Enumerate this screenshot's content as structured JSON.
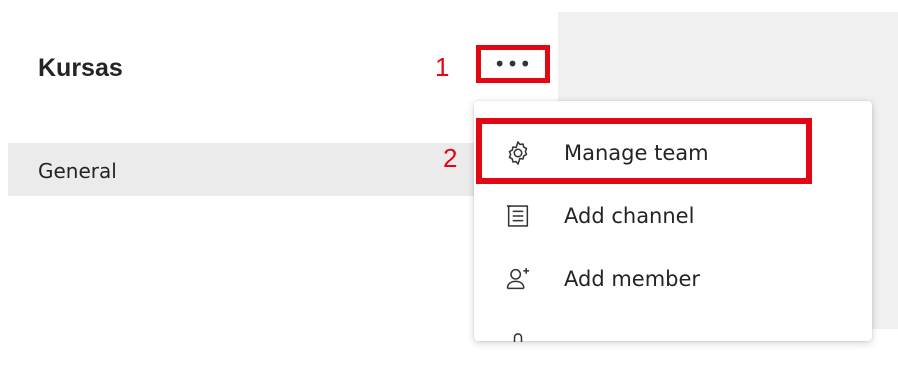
{
  "team": {
    "name": "Kursas",
    "more_button_label": "•••"
  },
  "channels": [
    {
      "label": "General"
    }
  ],
  "annotations": {
    "step1": "1",
    "step2": "2",
    "highlight_color": "#e30613"
  },
  "menu": {
    "items": [
      {
        "label": "Manage team",
        "icon": "gear-icon"
      },
      {
        "label": "Add channel",
        "icon": "channel-list-icon"
      },
      {
        "label": "Add member",
        "icon": "add-person-icon"
      },
      {
        "label": "",
        "icon": "partial-icon"
      }
    ]
  },
  "colors": {
    "background": "#ffffff",
    "side_panel": "#f0f0f0",
    "selected_row": "#ebebeb",
    "text": "#242424"
  }
}
